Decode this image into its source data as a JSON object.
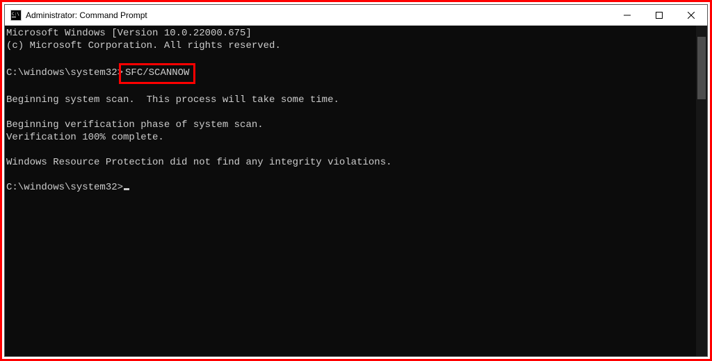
{
  "window": {
    "title": "Administrator: Command Prompt"
  },
  "terminal": {
    "header_line1": "Microsoft Windows [Version 10.0.22000.675]",
    "header_line2": "(c) Microsoft Corporation. All rights reserved.",
    "prompt1_path": "C:\\windows\\system32>",
    "prompt1_command": "SFC/SCANNOW",
    "out1": "Beginning system scan.  This process will take some time.",
    "out2": "Beginning verification phase of system scan.",
    "out3": "Verification 100% complete.",
    "out4": "Windows Resource Protection did not find any integrity violations.",
    "prompt2_path": "C:\\windows\\system32>"
  },
  "colors": {
    "highlight_border": "#ff0000",
    "terminal_bg": "#0c0c0c",
    "terminal_fg": "#cccccc"
  }
}
